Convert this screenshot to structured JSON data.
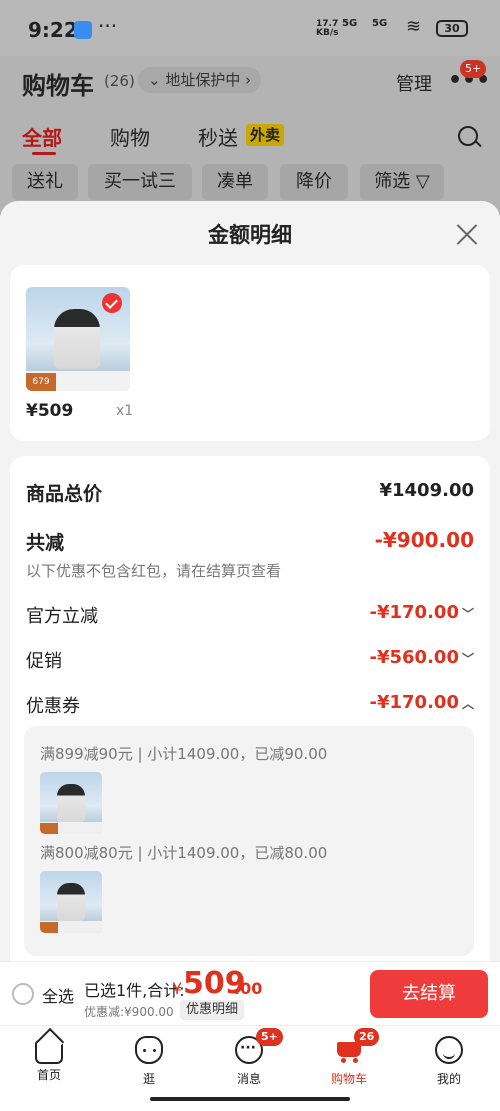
{
  "status_bar": {
    "time": "9:22",
    "more": "···",
    "net_speed": "17.7",
    "net_unit": "KB/s",
    "sig1": "5G",
    "sig2": "5G",
    "battery": "30"
  },
  "header": {
    "title": "购物车",
    "count": "(26)",
    "address_protect": "⌄ 地址保护中 ›",
    "manage": "管理",
    "more": "•••",
    "more_badge": "5+"
  },
  "tabs": [
    {
      "label": "全部",
      "active": true
    },
    {
      "label": "购物",
      "active": false
    },
    {
      "label": "秒送",
      "active": false
    }
  ],
  "tab_tag": "外卖",
  "chips": [
    "送礼",
    "买一试三",
    "凑单",
    "降价",
    "筛选 ▽"
  ],
  "sheet": {
    "title": "金额明细",
    "product": {
      "price": "¥509",
      "qty": "x1",
      "img_price": "679"
    },
    "total_label": "商品总价",
    "total_value": "¥1409.00",
    "reduce_label": "共减",
    "reduce_value": "-¥900.00",
    "reduce_note": "以下优惠不包含红包，请在结算页查看",
    "official_label": "官方立减",
    "official_value": "-¥170.00",
    "promo_label": "促销",
    "promo_value": "-¥560.00",
    "coupon_label": "优惠券",
    "coupon_value": "-¥170.00",
    "coupon_lines": [
      "满899减90元 | 小计1409.00，已减90.00",
      "满800减80元 | 小计1409.00，已减80.00"
    ]
  },
  "checkout": {
    "select_all": "全选",
    "selected_info": "已选1件,合计:",
    "yen": "¥",
    "total_int": "509",
    "total_dec": ".00",
    "saved": "优惠减:¥900.00",
    "detail_button": "优惠明细",
    "pay_button": "去结算"
  },
  "nav": [
    {
      "label": "首页",
      "icon": "home-icon"
    },
    {
      "label": "逛",
      "icon": "face-icon"
    },
    {
      "label": "消息",
      "icon": "message-icon",
      "badge": "5+"
    },
    {
      "label": "购物车",
      "icon": "cart-icon",
      "badge": "26",
      "active": true
    },
    {
      "label": "我的",
      "icon": "profile-icon"
    }
  ],
  "colors": {
    "accent": "#e0301e",
    "pay_button": "#ef3b3b",
    "tab_active": "#b41818"
  }
}
